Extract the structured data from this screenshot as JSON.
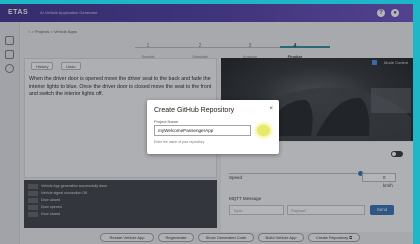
{
  "titlebar": {
    "brand": "ETAS",
    "app_title": "AI Vehicle Application Generator"
  },
  "breadcrumb": {
    "text": "⌂  >  Projects  >  Vehicle Apps"
  },
  "steps": [
    {
      "num": "1",
      "label": "Specify"
    },
    {
      "num": "2",
      "label": "Simulate"
    },
    {
      "num": "3",
      "label": "Analyze"
    },
    {
      "num": "4",
      "label": "Finalize"
    }
  ],
  "editor": {
    "tabs": [
      "History",
      "Undo"
    ],
    "text": "When the driver door is opened move the driver seat to the back and fade the interior lights to blue. Once the driver door is closed move the seat to the front and switch the interior lights off."
  },
  "log": [
    {
      "text": "Vehicle App generation successfully done"
    },
    {
      "text": "Vehicle signal connection OK"
    },
    {
      "text": "Door closed"
    },
    {
      "text": "Door opened"
    },
    {
      "text": "Door closed"
    }
  ],
  "viewer": {
    "checkbox_label": "Mode Control"
  },
  "panel": {
    "speed_label": "Speed",
    "speed_value": "0",
    "speed_unit": "km/h",
    "mqtt_label": "MQTT Message",
    "topic_placeholder": "Topic",
    "payload_placeholder": "Payload",
    "send_label": "Send"
  },
  "bottom_buttons": [
    "Restart Vehicle App",
    "Regenerate",
    "Show Generated Code",
    "Build Vehicle App",
    "Create Repository  ⧉"
  ],
  "modal": {
    "title": "Create GitHub Repository",
    "close": "×",
    "field_label": "Project Name",
    "field_value": "myWelcomePassengerApp",
    "hint": "Enter the name of your repository"
  }
}
